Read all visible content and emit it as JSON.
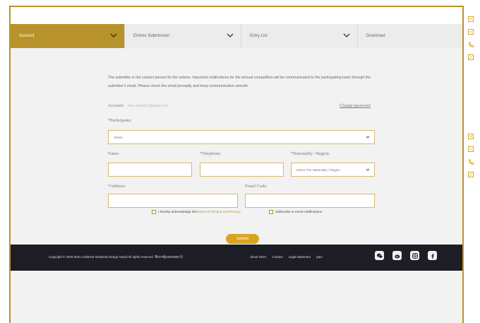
{
  "nav": {
    "tabs": [
      {
        "label": "Account",
        "active": true
      },
      {
        "label": "Entries Submission",
        "active": false
      },
      {
        "label": "Entry List",
        "active": false
      },
      {
        "label": "Download",
        "active": false
      }
    ]
  },
  "form": {
    "intro": "The submitter is the contact person for the entries. Important notifications for the annual competition will be communicated to the participating team through the submitter's email. Please check the email promptly and keep communication smooth.",
    "account_label": "Account:",
    "account_value": "eliza.hojastra@gmail.com",
    "change_password": "Change password",
    "participants_label": "*Participants:",
    "participants_select": "Select",
    "name_label": "Name:",
    "telephone_label": "*Telephone:",
    "nationality_label": "*Nationality / Region:",
    "nationality_select": "Select The Nationality / Region",
    "address_label": "*Address:",
    "postal_label": "Postal Code:",
    "ack_prefix": "I hereby acknowledge the ",
    "ack_link": "Terms of Service and Privacy",
    "subscribe_label": "Subscribe to event notifications",
    "submit": "Submit"
  },
  "footer": {
    "copyright": "Copyright © 2020-2021 Goldnest Industrial Design Award All rights reserved. 粤ICP备20003657号",
    "links": [
      "About GIDA",
      "Contact",
      "Legal statement",
      "Q&A"
    ],
    "social_icons": [
      "wechat-icon",
      "weibo-icon",
      "instagram-icon",
      "facebook-icon"
    ]
  },
  "colors": {
    "accent": "#b8922a",
    "submit": "#d9a521",
    "footer_bg": "#1d1d25"
  }
}
